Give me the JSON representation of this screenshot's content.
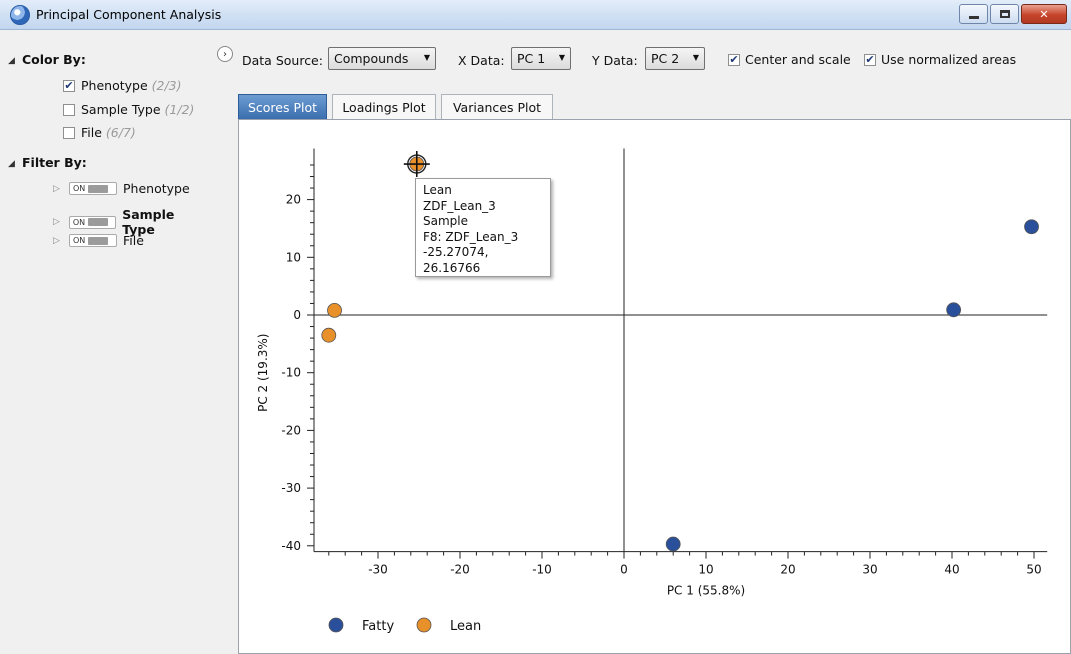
{
  "window": {
    "title": "Principal Component Analysis"
  },
  "icons": {
    "app": "app-icon",
    "minimize": "minimize-icon",
    "maximize": "maximize-icon",
    "close": "close-icon"
  },
  "color_by": {
    "heading": "Color By:",
    "items": [
      {
        "label": "Phenotype",
        "count": "(2/3)",
        "checked": true
      },
      {
        "label": "Sample Type",
        "count": "(1/2)",
        "checked": false
      },
      {
        "label": "File",
        "count": "(6/7)",
        "checked": false
      }
    ]
  },
  "filter_by": {
    "heading": "Filter By:",
    "toggle_text": "ON",
    "items": [
      {
        "label": "Phenotype",
        "bold": false
      },
      {
        "label": "Sample Type",
        "bold": true
      },
      {
        "label": "File",
        "bold": false
      }
    ]
  },
  "toolbar": {
    "data_source_label": "Data Source:",
    "data_source_value": "Compounds",
    "x_label": "X Data:",
    "x_value": "PC 1",
    "y_label": "Y Data:",
    "y_value": "PC 2",
    "center_scale_label": "Center and scale",
    "center_scale_checked": true,
    "normalized_label": "Use normalized areas",
    "normalized_checked": true
  },
  "tabs": [
    {
      "label": "Scores Plot",
      "active": true
    },
    {
      "label": "Loadings Plot",
      "active": false
    },
    {
      "label": "Variances Plot",
      "active": false
    }
  ],
  "tooltip": {
    "lines": [
      "Lean",
      "ZDF_Lean_3",
      "Sample",
      "F8: ZDF_Lean_3",
      "-25.27074, 26.16766"
    ]
  },
  "chart_data": {
    "type": "scatter",
    "xlabel": "PC 1 (55.8%)",
    "ylabel": "PC 2 (19.3%)",
    "xlim": [
      -37,
      51
    ],
    "ylim": [
      -41,
      28
    ],
    "xticks": [
      -30,
      -20,
      -10,
      0,
      10,
      20,
      30,
      40,
      50
    ],
    "yticks": [
      20,
      10,
      0,
      -10,
      -20,
      -30,
      -40
    ],
    "legend_position": "bottom",
    "series": [
      {
        "name": "Fatty",
        "color": "#2a4f9b",
        "points": [
          [
            49.7,
            15.3
          ],
          [
            40.2,
            0.9
          ],
          [
            6.0,
            -39.7
          ]
        ]
      },
      {
        "name": "Lean",
        "color": "#e8902a",
        "points": [
          [
            -35.3,
            0.8
          ],
          [
            -36.0,
            -3.5
          ],
          [
            -25.27074,
            26.16766
          ]
        ]
      }
    ],
    "highlighted_point": [
      -25.27074,
      26.16766
    ]
  }
}
